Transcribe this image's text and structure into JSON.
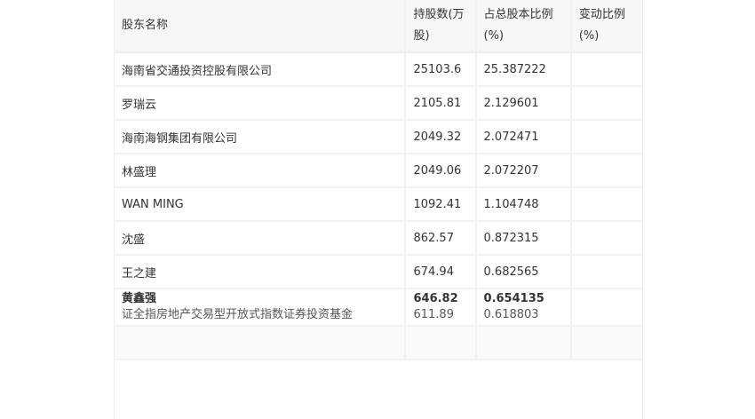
{
  "headers": {
    "name": "股东名称",
    "shares": "持股数(万股)",
    "percent": "占总股本比例(%)",
    "change": "变动比例(%)"
  },
  "rows": [
    {
      "name": "海南省交通投资控股有限公司",
      "shares": "25103.6",
      "percent": "25.387222",
      "change": ""
    },
    {
      "name": "罗瑞云",
      "shares": "2105.81",
      "percent": "2.129601",
      "change": ""
    },
    {
      "name": "海南海钢集团有限公司",
      "shares": "2049.32",
      "percent": "2.072471",
      "change": ""
    },
    {
      "name": "林盛理",
      "shares": "2049.06",
      "percent": "2.072207",
      "change": ""
    },
    {
      "name": "WAN MING",
      "shares": "1092.41",
      "percent": "1.104748",
      "change": ""
    },
    {
      "name": "沈盛",
      "shares": "862.57",
      "percent": "0.872315",
      "change": ""
    },
    {
      "name": "王之建",
      "shares": "674.94",
      "percent": "0.682565",
      "change": ""
    }
  ],
  "overlap_row": {
    "name_a": "黄鑫强",
    "name_b": "证全指房地产交易型开放式指数证券投资基金",
    "shares_a": "646.82",
    "shares_b": "611.89",
    "percent_a": "0.654135",
    "percent_b": "0.618803"
  }
}
